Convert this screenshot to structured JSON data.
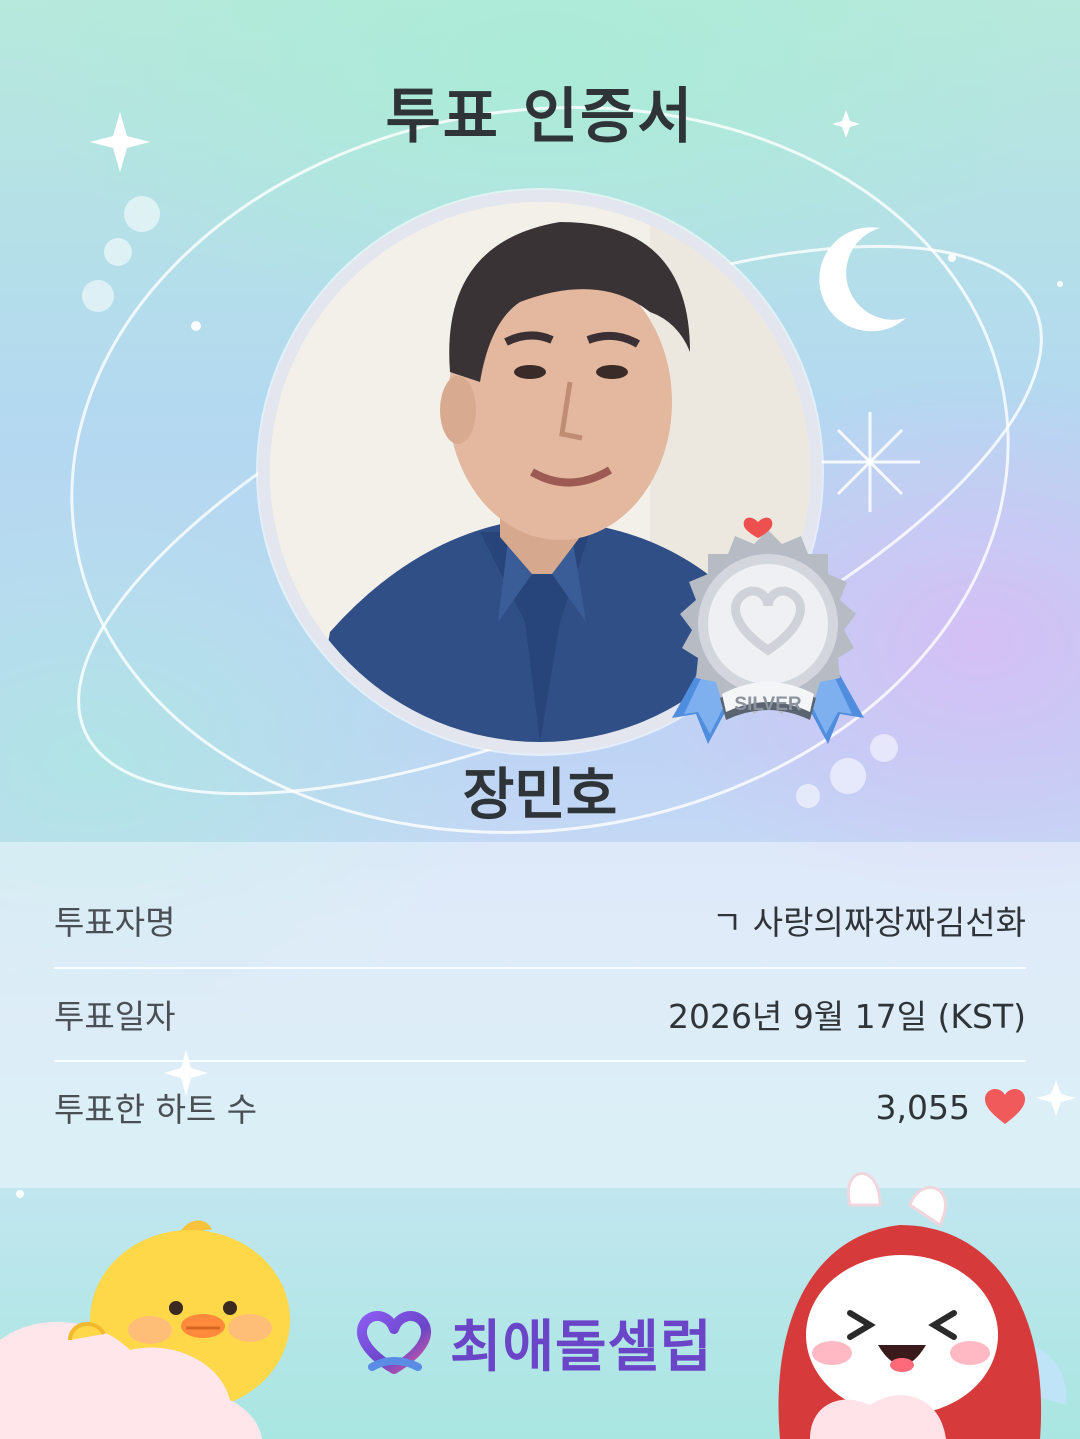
{
  "certificate": {
    "title": "투표 인증서",
    "artist_name": "장민호",
    "badge_label": "SILVER"
  },
  "details": {
    "rows": [
      {
        "label": "투표자명",
        "value": "ㄱ 사랑의짜장짜김선화"
      },
      {
        "label": "투표일자",
        "value": "2026년 9월 17일 (KST)"
      },
      {
        "label": "투표한 하트 수",
        "value": "3,055"
      }
    ]
  },
  "brand": {
    "name": "최애돌셀럽"
  },
  "icons": {
    "heart": "heart-icon",
    "logo": "choeaedol-logo-icon",
    "medal": "silver-medal-icon"
  },
  "colors": {
    "heart": "#f05a5a",
    "brand": "#6a45c8",
    "title": "#2f3438"
  }
}
